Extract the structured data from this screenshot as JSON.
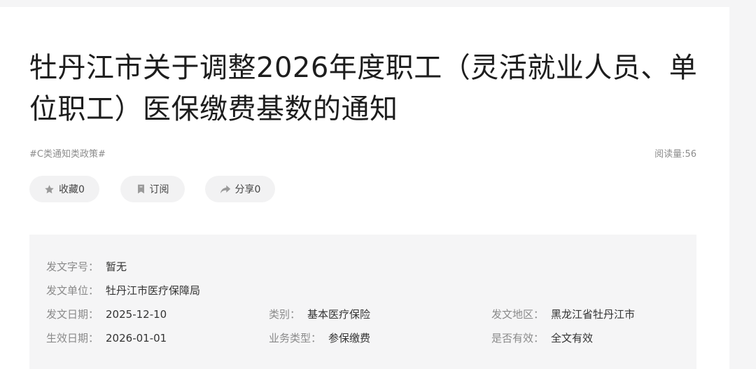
{
  "title": "牡丹江市关于调整2026年度职工（灵活就业人员、单位职工）医保缴费基数的通知",
  "tag": "#C类通知类政策#",
  "read_count": "阅读量:56",
  "actions": {
    "favorite": "收藏0",
    "subscribe": "订阅",
    "share": "分享0"
  },
  "meta": {
    "doc_no_label": "发文字号：",
    "doc_no": "暂无",
    "issuer_label": "发文单位：",
    "issuer": "牡丹江市医疗保障局",
    "issue_date_label": "发文日期：",
    "issue_date": "2025-12-10",
    "category_label": "类别：",
    "category": "基本医疗保险",
    "region_label": "发文地区：",
    "region": "黑龙江省牡丹江市",
    "effective_date_label": "生效日期：",
    "effective_date": "2026-01-01",
    "business_type_label": "业务类型：",
    "business_type": "参保缴费",
    "validity_label": "是否有效：",
    "validity": "全文有效"
  },
  "icons": {
    "favorite": "star-icon",
    "subscribe": "bookmark-icon",
    "share": "share-arrow-icon"
  }
}
